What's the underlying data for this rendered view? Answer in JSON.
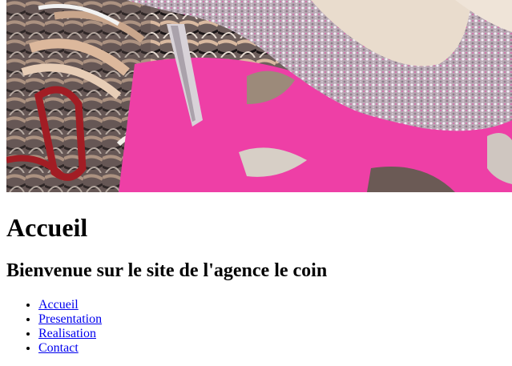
{
  "header": {
    "banner_image": "shoe-banner"
  },
  "main": {
    "title": "Accueil",
    "subtitle": "Bienvenue sur le site de l'agence le coin"
  },
  "nav": {
    "items": [
      {
        "label": "Accueil"
      },
      {
        "label": "Presentation"
      },
      {
        "label": "Realisation"
      },
      {
        "label": "Contact"
      }
    ]
  },
  "colors": {
    "link": "#0000ee",
    "text": "#000000",
    "background": "#ffffff",
    "banner_pink": "#ee3fa6"
  }
}
